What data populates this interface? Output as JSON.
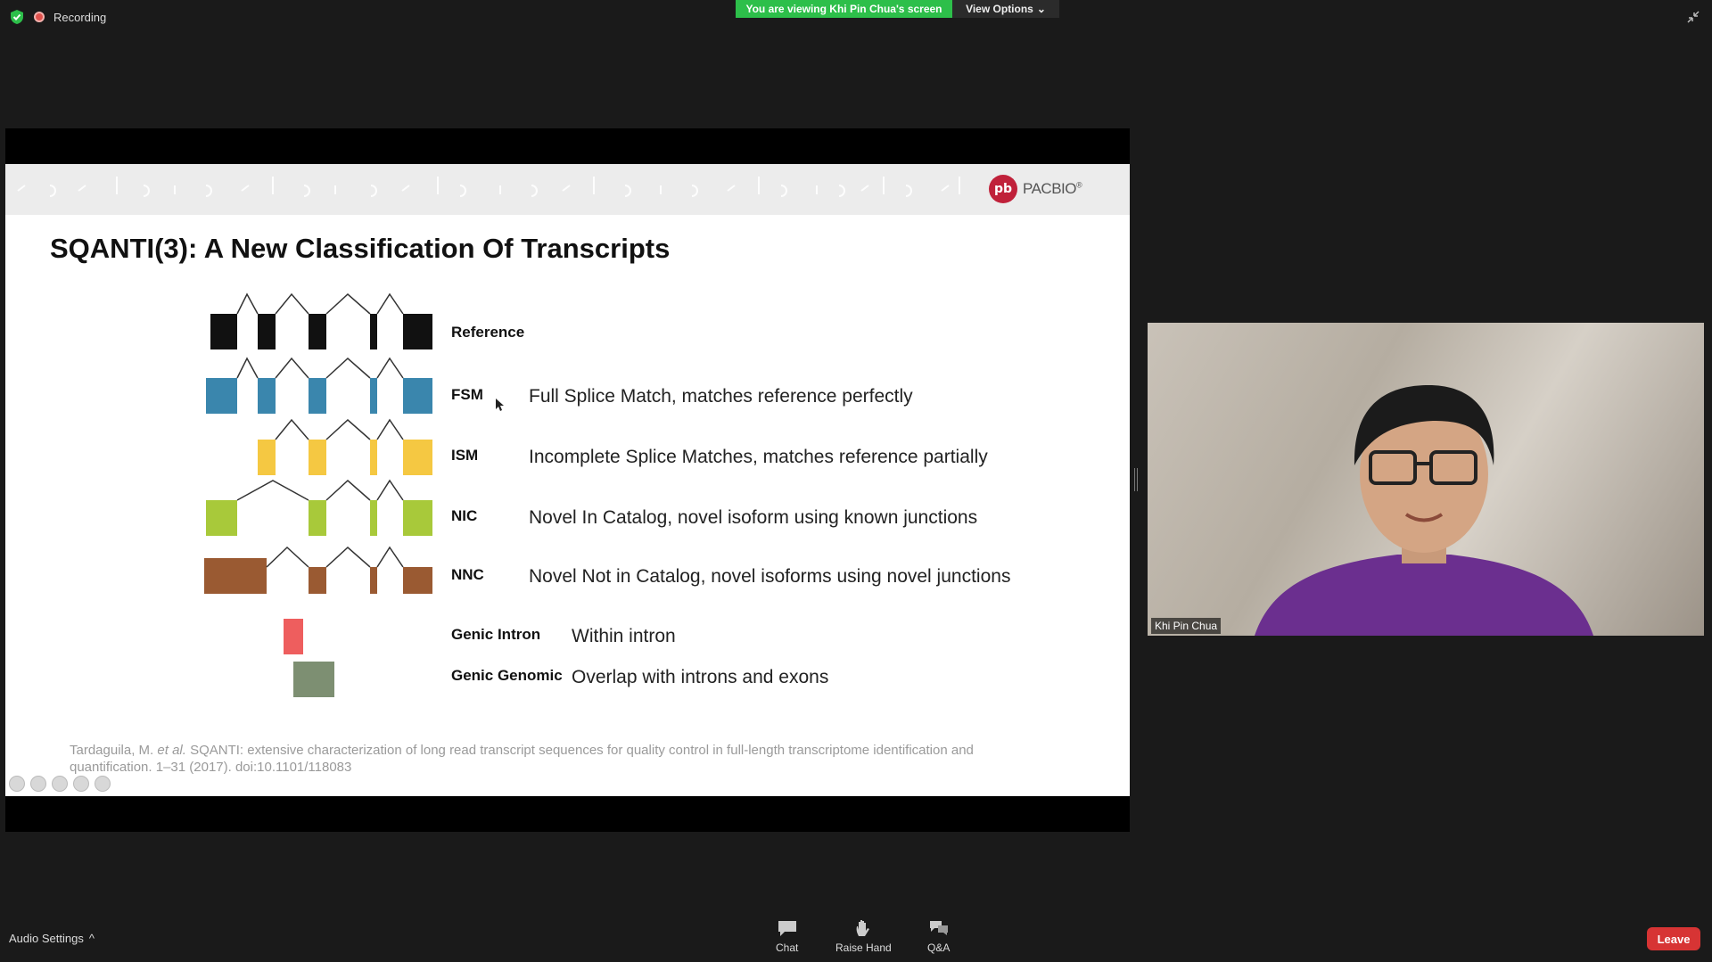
{
  "top_bar": {
    "recording_label": "Recording",
    "viewing_banner": "You are viewing Khi Pin Chua's screen",
    "view_options_label": "View Options",
    "view_options_caret": "⌄"
  },
  "slide": {
    "logo_badge": "pb",
    "logo_text": "PACBIO",
    "logo_mark": "®",
    "title": "SQANTI(3): A New Classification Of Transcripts",
    "classes": [
      {
        "label": "Reference",
        "description": "",
        "color": "#111111"
      },
      {
        "label": "FSM",
        "description": "Full Splice Match, matches reference perfectly",
        "color": "#3a86ad"
      },
      {
        "label": "ISM",
        "description": "Incomplete Splice Matches, matches reference partially",
        "color": "#f5c842"
      },
      {
        "label": "NIC",
        "description": "Novel In Catalog, novel isoform using known junctions",
        "color": "#a8c93a"
      },
      {
        "label": "NNC",
        "description": "Novel Not in Catalog, novel isoforms using novel junctions",
        "color": "#9a5a32"
      },
      {
        "label": "Genic Intron",
        "description": "Within intron",
        "color": "#ee5e5e"
      },
      {
        "label": "Genic Genomic",
        "description": "Overlap with introns and exons",
        "color": "#7d8f72"
      }
    ],
    "citation_authors": "Tardaguila, M.",
    "citation_etal": "et al.",
    "citation_text": "SQANTI: extensive characterization of long read transcript sequences for quality control in full-length transcriptome identification and quantification. 1–31 (2017). doi:10.1101/118083"
  },
  "participant": {
    "name": "Khi Pin Chua"
  },
  "bottom_bar": {
    "audio_settings_label": "Audio Settings",
    "audio_settings_caret": "^",
    "chat_label": "Chat",
    "raise_hand_label": "Raise Hand",
    "qa_label": "Q&A",
    "leave_label": "Leave"
  },
  "colors": {
    "banner_green": "#2dbf4a",
    "leave_red": "#d73434",
    "brand_red": "#c0213a"
  }
}
